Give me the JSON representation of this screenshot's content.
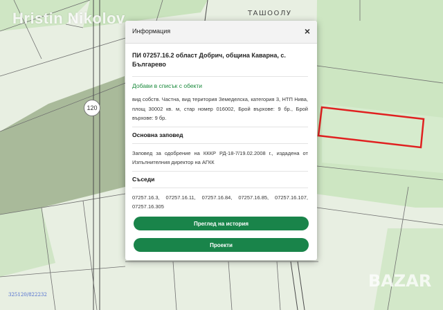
{
  "watermark": "Hristin Nikolov",
  "map": {
    "area_label": "ТАШООЛУ",
    "road_number": "120",
    "coordinate_readout": "325120/822232",
    "logo_text": "BAZAR",
    "highlight_color": "#e02020"
  },
  "dialog": {
    "title": "Информация",
    "close_glyph": "×",
    "parcel_title": "ПИ 07257.16.2 област Добрич, община Каварна, с. Българево",
    "add_to_list": "Добави в списък с обекти",
    "details": "вид собств. Частна, вид територия Земеделска, категория 3, НТП Нива, площ 30002 кв. м, стар номер 016002, Брой върхове: 9 бр., Брой върхове: 9 бр.",
    "order_heading": "Основна заповед",
    "order_text": "Заповед за одобрение на КККР РД-18-7/19.02.2008 г., издадена от Изпълнителния директор на АГКК",
    "neighbors_heading": "Съседи",
    "neighbors_text": "07257.16.3,    07257.16.11,    07257.16.84,    07257.16.85, 07257.16.107, 07257.16.305",
    "history_button": "Преглед на история",
    "projects_button": "Проекти",
    "button_color": "#19844a",
    "link_color": "#1a8a3c"
  }
}
